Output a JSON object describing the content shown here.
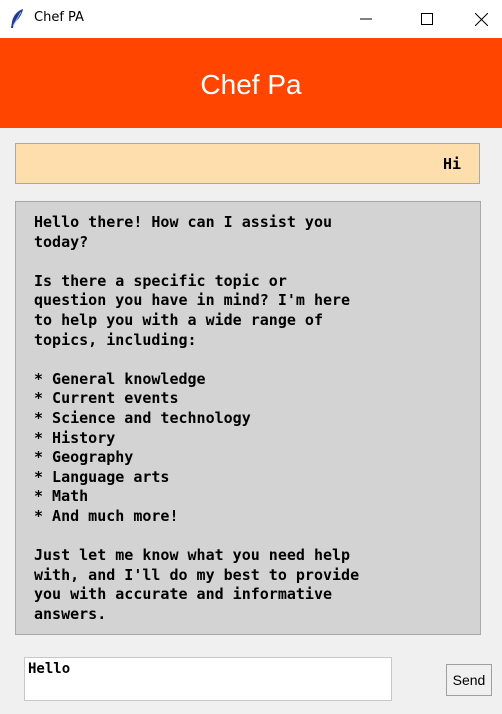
{
  "window": {
    "title": "Chef PA",
    "icon": "feather-icon",
    "controls": [
      "minimize-icon",
      "maximize-icon",
      "close-icon"
    ]
  },
  "header": {
    "title": "Chef Pa",
    "background": "#ff4500",
    "text_color": "#ffffff"
  },
  "chat": {
    "user_message": "Hi",
    "user_bubble_color": "#ffdead",
    "bot_reply": "Hello there! How can I assist you\ntoday?\n\nIs there a specific topic or\nquestion you have in mind? I'm here\nto help you with a wide range of\ntopics, including:\n\n* General knowledge\n* Current events\n* Science and technology\n* History\n* Geography\n* Language arts\n* Math\n* And much more!\n\nJust let me know what you need help\nwith, and I'll do my best to provide\nyou with accurate and informative\nanswers.",
    "bot_bubble_color": "#d3d3d3"
  },
  "composer": {
    "input_value": "Hello",
    "send_label": "Send"
  }
}
